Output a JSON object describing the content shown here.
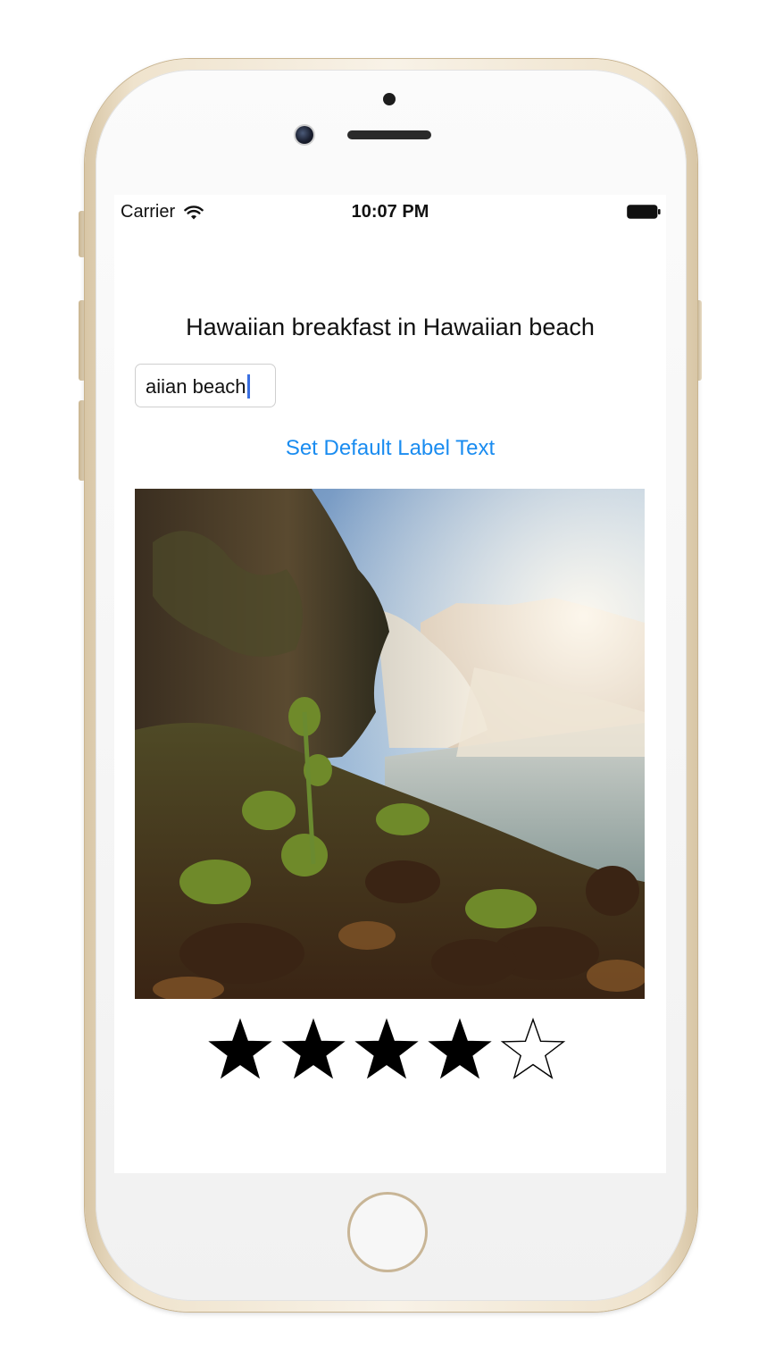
{
  "status_bar": {
    "carrier": "Carrier",
    "time": "10:07 PM"
  },
  "main": {
    "label_text": "Hawaiian breakfast in Hawaiian beach",
    "text_field_value": "aiian beach",
    "set_default_button": "Set Default Label Text",
    "photo_icon": "waterfall-photo",
    "rating": {
      "value": 4,
      "max": 5
    }
  },
  "colors": {
    "accent": "#1a8cf0",
    "caret": "#3a6fe0",
    "star": "#000000"
  },
  "icons": {
    "wifi": "wifi-icon",
    "battery": "battery-icon",
    "star_filled": "star-filled-icon",
    "star_empty": "star-empty-icon"
  }
}
